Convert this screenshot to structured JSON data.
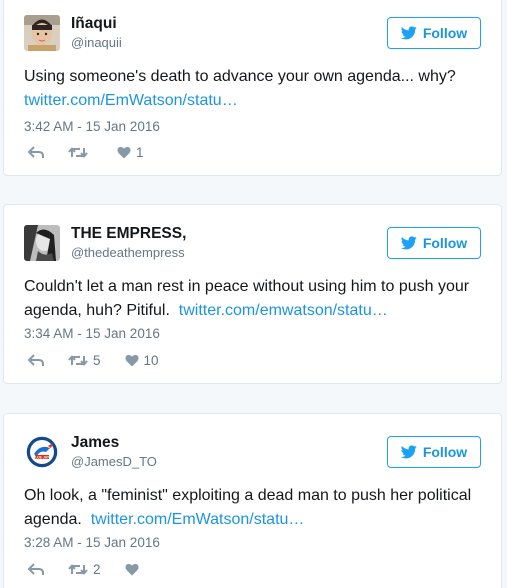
{
  "tweets": [
    {
      "name": "Iñaqui",
      "handle": "@inaquii",
      "text": "Using someone's death to advance your own agenda... why?",
      "link": "twitter.com/EmWatson/statu…",
      "timestamp": "3:42 AM - 15 Jan 2016",
      "retweets": "",
      "likes": "1",
      "follow_label": "Follow"
    },
    {
      "name": "THE EMPRESS,",
      "handle": "@thedeathempress",
      "text": "Couldn't let a man rest in peace without using him to push your agenda, huh? Pitiful.",
      "link": "twitter.com/emwatson/statu…",
      "timestamp": "3:34 AM - 15 Jan 2016",
      "retweets": "5",
      "likes": "10",
      "follow_label": "Follow"
    },
    {
      "name": "James",
      "handle": "@JamesD_TO",
      "text": "Oh look, a \"feminist\" exploiting a dead man to push her political agenda.",
      "link": "twitter.com/EmWatson/statu…",
      "timestamp": "3:28 AM - 15 Jan 2016",
      "retweets": "2",
      "likes": "",
      "follow_label": "Follow"
    }
  ],
  "colors": {
    "accent": "#1da1f2",
    "link": "#1b95e0",
    "muted": "#657786",
    "border": "#e1e8ed",
    "background": "#f5f8fa"
  },
  "icons": [
    "twitter-bird-icon",
    "reply-icon",
    "retweet-icon",
    "heart-icon"
  ],
  "avatar_badge_text": "BLUE JAYS"
}
